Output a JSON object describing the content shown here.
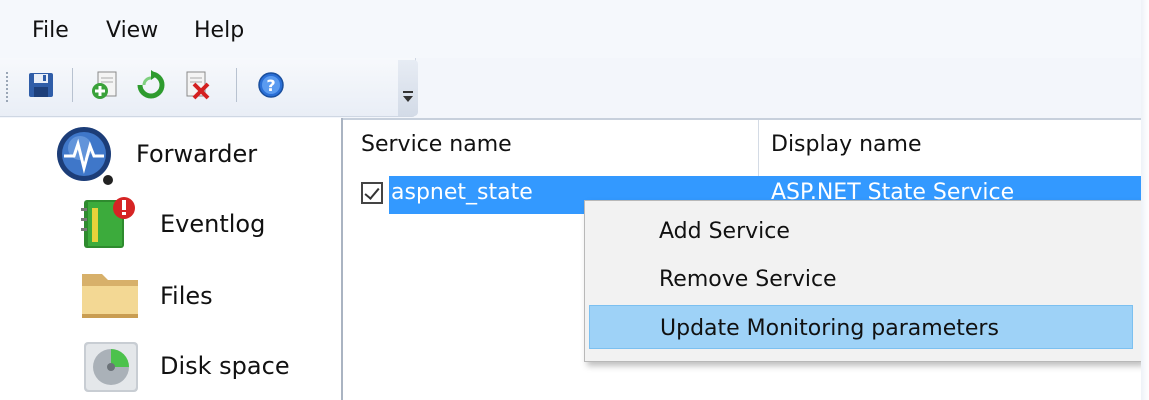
{
  "menu": {
    "file": "File",
    "view": "View",
    "help": "Help"
  },
  "toolbar": {
    "buttons": [
      "save-icon",
      "add-icon",
      "refresh-icon",
      "delete-icon",
      "help-icon"
    ]
  },
  "tree": {
    "items": [
      {
        "label": "Forwarder",
        "icon": "forwarder-icon"
      },
      {
        "label": "Eventlog",
        "icon": "eventlog-icon"
      },
      {
        "label": "Files",
        "icon": "folder-icon"
      },
      {
        "label": "Disk space",
        "icon": "disk-icon"
      }
    ]
  },
  "list": {
    "columns": [
      "Service name",
      "Display name"
    ],
    "rows": [
      {
        "checked": true,
        "service_name": "aspnet_state",
        "display_name": "ASP.NET State Service"
      }
    ]
  },
  "context_menu": {
    "items": [
      "Add Service",
      "Remove Service",
      "Update Monitoring parameters"
    ],
    "highlighted_index": 2
  },
  "colors": {
    "selection": "#3399ff",
    "menu_highlight": "#9ed2f7"
  }
}
